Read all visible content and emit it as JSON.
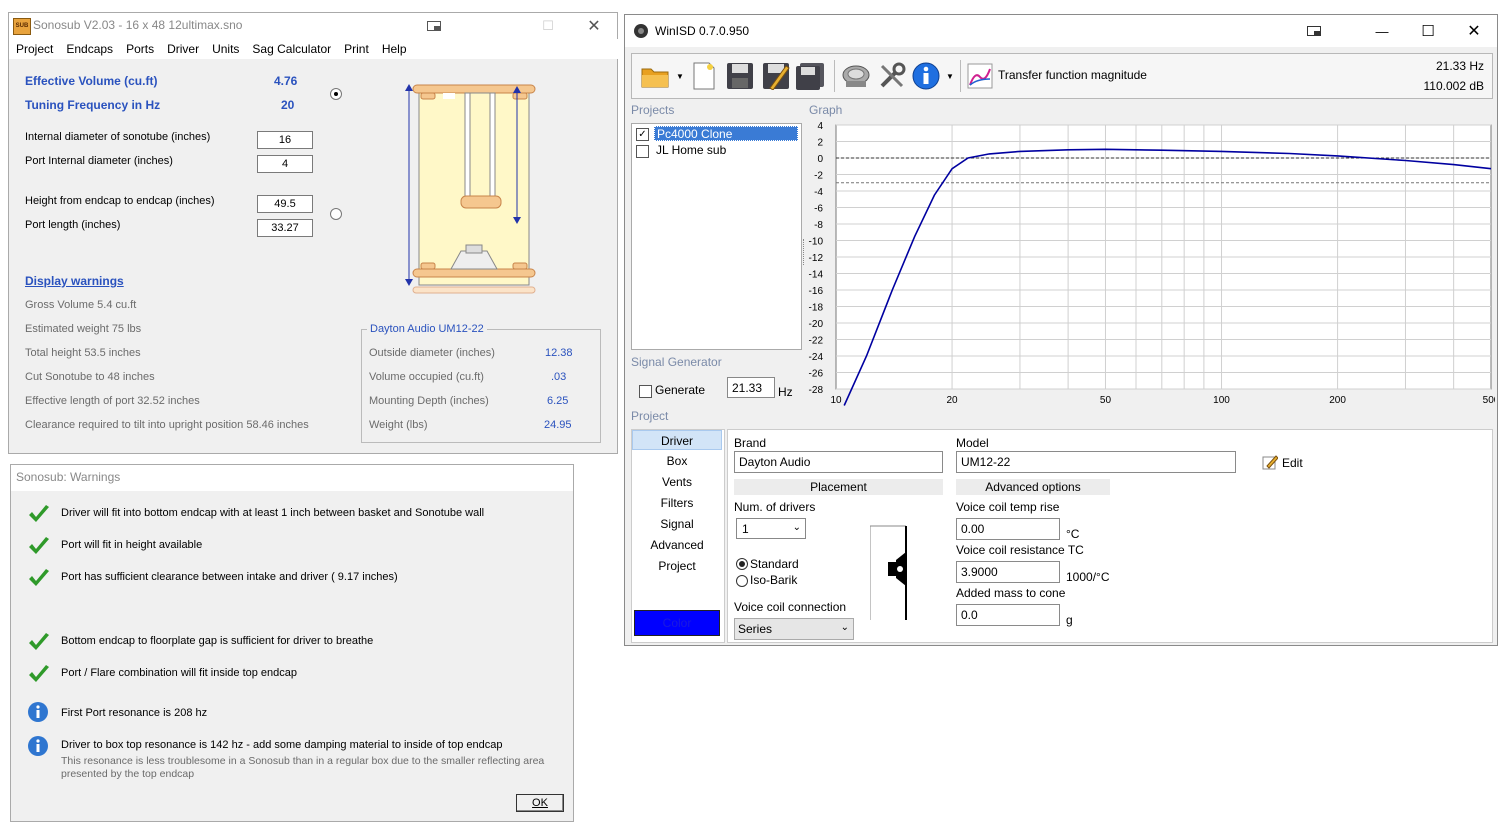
{
  "sonosub": {
    "title": "Sonosub V2.03 - 16 x 48 12ultimax.sno",
    "app_icon_text": "SUB",
    "menu": [
      "Project",
      "Endcaps",
      "Ports",
      "Driver",
      "Units",
      "Sag Calculator",
      "Print",
      "Help"
    ],
    "effective_volume_label": "Effective Volume (cu.ft)",
    "effective_volume_value": "4.76",
    "tuning_label": "Tuning Frequency in Hz",
    "tuning_value": "20",
    "inputs": [
      {
        "label": "Internal diameter of sonotube (inches)",
        "value": "16"
      },
      {
        "label": "Port Internal diameter (inches)",
        "value": "4"
      },
      {
        "label": "Height from endcap to endcap (inches)",
        "value": "49.5"
      },
      {
        "label": "Port length (inches)",
        "value": "33.27"
      }
    ],
    "display_warnings": "Display warnings",
    "stats": [
      "Gross Volume  5.4 cu.ft",
      "Estimated weight  75 lbs",
      "Total height  53.5 inches",
      "Cut Sonotube to   48 inches",
      "Effective length of port  32.52 inches",
      "Clearance required to tilt into upright position  58.46 inches"
    ],
    "driver_box": {
      "title": "Dayton Audio UM12-22",
      "rows": [
        {
          "label": "Outside diameter (inches)",
          "value": "12.38"
        },
        {
          "label": "Volume occupied (cu.ft)",
          "value": ".03"
        },
        {
          "label": "Mounting Depth (inches)",
          "value": "6.25"
        },
        {
          "label": "Weight (lbs)",
          "value": "24.95"
        }
      ]
    }
  },
  "warnings": {
    "title": "Sonosub: Warnings",
    "items": [
      {
        "icon": "check-icon",
        "text": "Driver will fit into bottom endcap with at least 1 inch between basket and Sonotube wall"
      },
      {
        "icon": "check-icon",
        "text": "Port will fit in height available"
      },
      {
        "icon": "check-icon",
        "text": "Port has sufficient clearance between intake and driver ( 9.17 inches)"
      },
      {
        "icon": "check-icon",
        "text": "Bottom endcap to floorplate gap is sufficient for driver to breathe"
      },
      {
        "icon": "check-icon",
        "text": "Port / Flare combination will fit inside top endcap"
      },
      {
        "icon": "info-icon",
        "text": "First Port resonance is   208 hz"
      },
      {
        "icon": "info-icon",
        "text": "Driver to box top resonance is  142 hz - add some damping material to inside of top endcap"
      }
    ],
    "note_line1": "This resonance is less troublesome in a Sonosub than in a regular box due to the smaller reflecting area",
    "note_line2": "presented by the top endcap",
    "ok": "OK"
  },
  "winisd": {
    "title": "WinISD 0.7.0.950",
    "graph_type": "Transfer function magnitude",
    "readout_freq": "21.33 Hz",
    "readout_db": "110.002 dB",
    "projects_label": "Projects",
    "graph_label": "Graph",
    "projects": [
      {
        "name": "Pc4000 Clone",
        "checked": true,
        "selected": true
      },
      {
        "name": "JL Home sub",
        "checked": false,
        "selected": false
      }
    ],
    "signal_generator_label": "Signal Generator",
    "generate_label": "Generate",
    "generate_value": "21.33",
    "generate_unit": "Hz",
    "project_label": "Project",
    "sidebar": [
      "Driver",
      "Box",
      "Vents",
      "Filters",
      "Signal",
      "Advanced",
      "Project"
    ],
    "color_button": "Color",
    "brand_label": "Brand",
    "brand_value": "Dayton Audio",
    "model_label": "Model",
    "model_value": "UM12-22",
    "edit_label": "Edit",
    "placement_header": "Placement",
    "advanced_header": "Advanced options",
    "num_drivers_label": "Num. of drivers",
    "num_drivers_value": "1",
    "standard_label": "Standard",
    "isobarik_label": "Iso-Barik",
    "voice_coil_conn_label": "Voice coil connection",
    "voice_coil_conn_value": "Series",
    "vc_temp_label": "Voice coil temp rise",
    "vc_temp_value": "0.00",
    "vc_temp_unit": "°C",
    "vc_res_label": "Voice coil resistance TC",
    "vc_res_value": "3.9000",
    "vc_res_unit": "1000/°C",
    "added_mass_label": "Added mass to cone",
    "added_mass_value": "0.0",
    "added_mass_unit": "g"
  },
  "chart_data": {
    "type": "line",
    "x_scale": "log",
    "xlim": [
      10,
      500
    ],
    "ylim": [
      -28,
      4
    ],
    "x_ticks": [
      10,
      20,
      50,
      100,
      200,
      500
    ],
    "y_ticks": [
      4,
      2,
      0,
      -2,
      -4,
      -6,
      -8,
      -10,
      -12,
      -14,
      -16,
      -18,
      -20,
      -22,
      -24,
      -26,
      -28
    ],
    "reference_lines_db": [
      0,
      -3
    ],
    "grid": true,
    "series": [
      {
        "color": "#0000a0",
        "x": [
          10.5,
          12,
          14,
          16,
          18,
          20,
          22,
          25,
          30,
          40,
          50,
          70,
          100,
          150,
          200,
          300,
          400,
          500
        ],
        "y": [
          -30,
          -24,
          -16,
          -9.5,
          -4.5,
          -1.3,
          0,
          0.5,
          0.8,
          1.0,
          1.05,
          0.95,
          0.8,
          0.55,
          0.25,
          -0.3,
          -0.8,
          -1.3
        ]
      }
    ]
  }
}
